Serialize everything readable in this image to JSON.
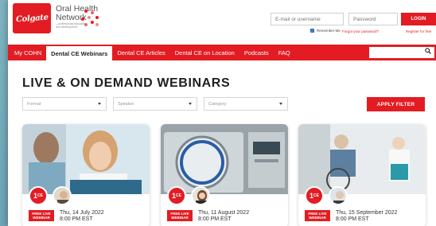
{
  "brand": {
    "logo": "Colgate",
    "network_title_line1": "Oral Health",
    "network_title_line2": "Network",
    "network_sub": "—professional education and development",
    "primary_color": "#e31c23"
  },
  "login": {
    "email_placeholder": "E-mail or username",
    "password_placeholder": "Password",
    "login_label": "LOGIN",
    "remember_label": "Remember Me",
    "forgot_label": "Forgot your password?",
    "register_label": "Register for free"
  },
  "nav": {
    "items": [
      {
        "label": "My COHN"
      },
      {
        "label": "Dental CE Webinars"
      },
      {
        "label": "Dental CE Articles"
      },
      {
        "label": "Dental CE on Location"
      },
      {
        "label": "Podcasts"
      },
      {
        "label": "FAQ"
      }
    ],
    "active_index": 1
  },
  "main": {
    "title": "LIVE & ON DEMAND WEBINARS",
    "filters": [
      {
        "placeholder": "Format"
      },
      {
        "placeholder": "Speaker"
      },
      {
        "placeholder": "Category"
      }
    ],
    "apply_label": "APPLY FILTER"
  },
  "cards": [
    {
      "ce": "1",
      "ce_unit": "CE",
      "tag_line1": "FREE LIVE",
      "tag_line2": "WEBINAR",
      "date": "Thu, 14 July 2022",
      "time": "8:00 PM EST"
    },
    {
      "ce": "1",
      "ce_unit": "CE",
      "tag_line1": "FREE LIVE",
      "tag_line2": "WEBINAR",
      "date": "Thu, 11 August 2022",
      "time": "8:00 PM EST"
    },
    {
      "ce": "1",
      "ce_unit": "CE",
      "tag_line1": "FREE LIVE",
      "tag_line2": "WEBINAR",
      "date": "Thu, 15 September 2022",
      "time": "8:00 PM EST"
    }
  ]
}
